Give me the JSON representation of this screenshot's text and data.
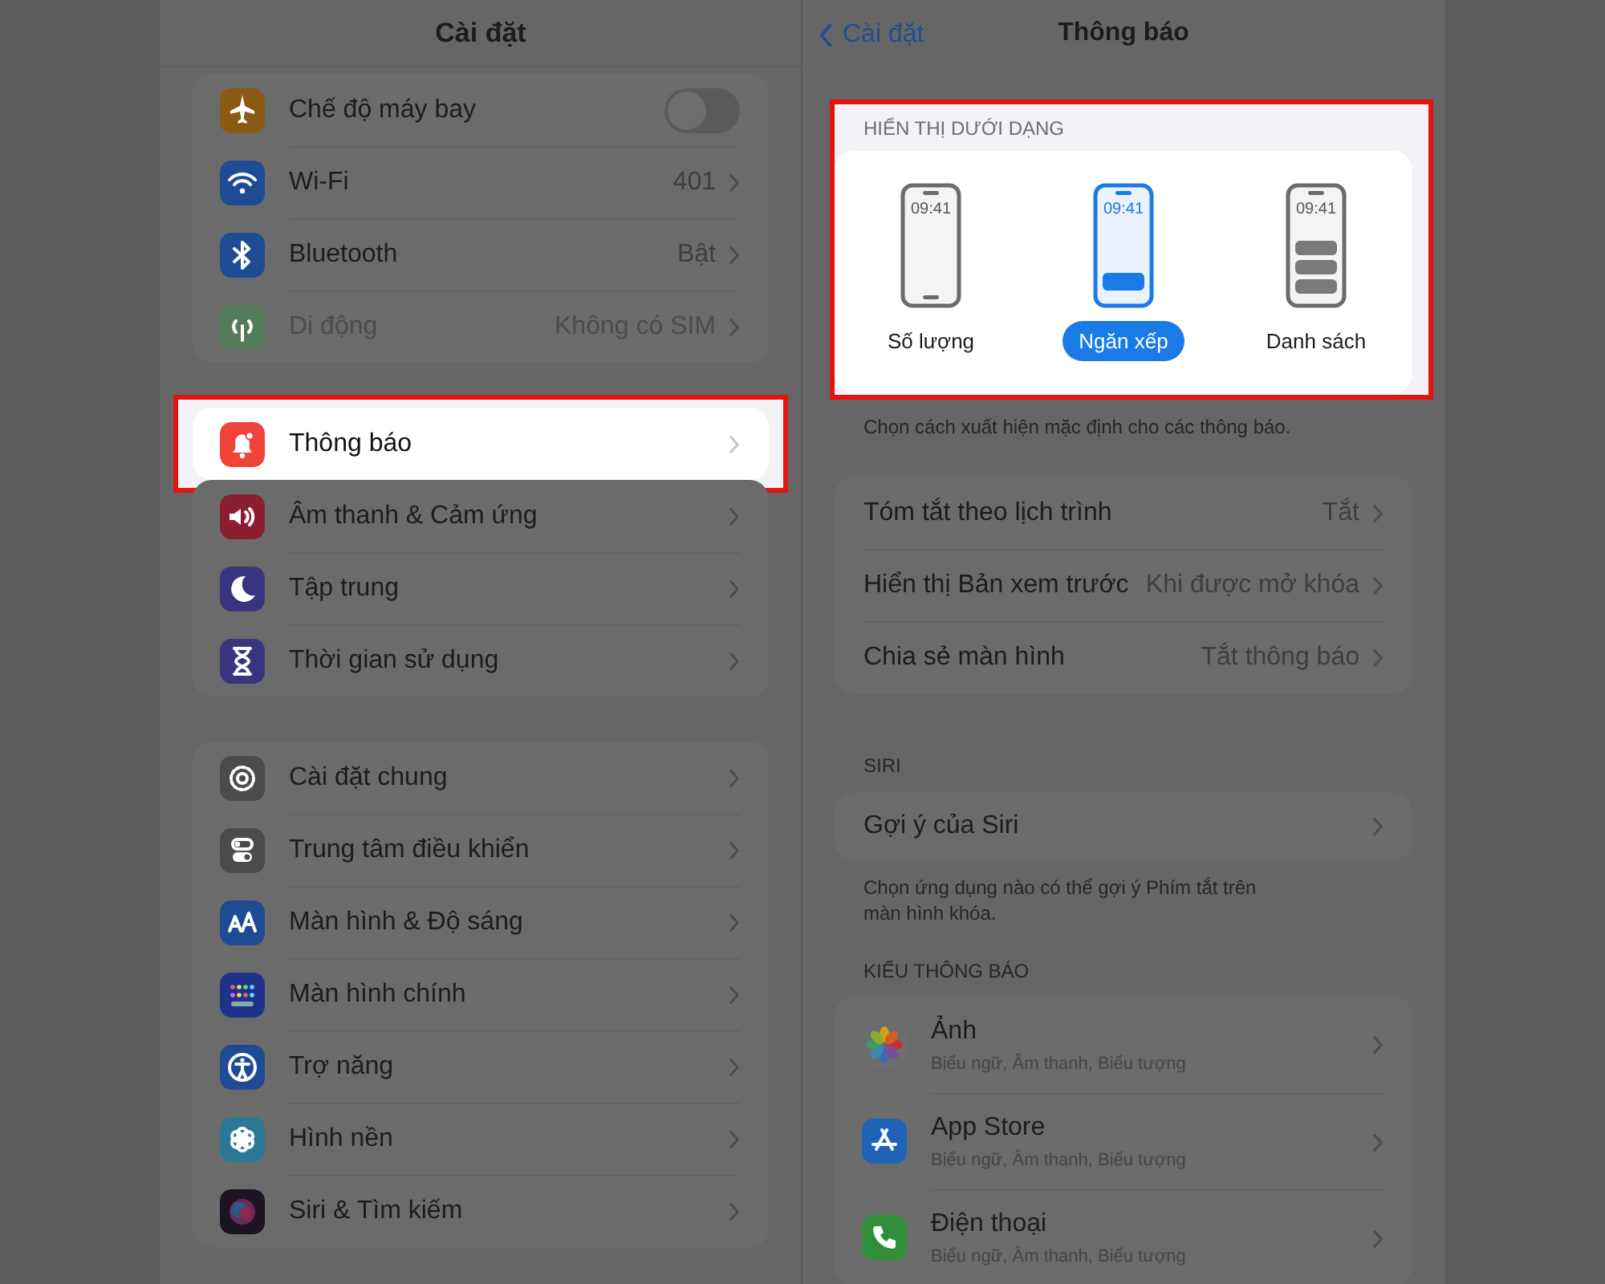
{
  "settings": {
    "title": "Cài đặt",
    "groups": [
      {
        "items": [
          {
            "label": "Chế độ máy bay",
            "kind": "toggle",
            "on": false,
            "highlighted": false,
            "disabled": false
          },
          {
            "label": "Wi-Fi",
            "value": "401",
            "kind": "link",
            "highlighted": false,
            "disabled": false
          },
          {
            "label": "Bluetooth",
            "value": "Bật",
            "kind": "link",
            "highlighted": false,
            "disabled": false
          },
          {
            "label": "Di động",
            "value": "Không có SIM",
            "kind": "link",
            "highlighted": false,
            "disabled": true
          }
        ]
      },
      {
        "items": [
          {
            "label": "Thông báo",
            "kind": "link",
            "highlighted": true,
            "disabled": false
          },
          {
            "label": "Âm thanh & Cảm ứng",
            "kind": "link",
            "highlighted": false,
            "disabled": false
          },
          {
            "label": "Tập trung",
            "kind": "link",
            "highlighted": false,
            "disabled": false
          },
          {
            "label": "Thời gian sử dụng",
            "kind": "link",
            "highlighted": false,
            "disabled": false
          }
        ]
      },
      {
        "items": [
          {
            "label": "Cài đặt chung",
            "kind": "link",
            "highlighted": false,
            "disabled": false
          },
          {
            "label": "Trung tâm điều khiển",
            "kind": "link",
            "highlighted": false,
            "disabled": false
          },
          {
            "label": "Màn hình & Độ sáng",
            "kind": "link",
            "highlighted": false,
            "disabled": false
          },
          {
            "label": "Màn hình chính",
            "kind": "link",
            "highlighted": false,
            "disabled": false
          },
          {
            "label": "Trợ năng",
            "kind": "link",
            "highlighted": false,
            "disabled": false
          },
          {
            "label": "Hình nền",
            "kind": "link",
            "highlighted": false,
            "disabled": false
          },
          {
            "label": "Siri & Tìm kiếm",
            "kind": "link",
            "highlighted": false,
            "disabled": false
          }
        ]
      }
    ]
  },
  "notifications": {
    "back": "Cài đặt",
    "title": "Thông báo",
    "display_as": {
      "header": "HIỂN THỊ DƯỚI DẠNG",
      "highlighted": true,
      "options": [
        {
          "kind": "count",
          "time": "09:41",
          "label": "Số lượng",
          "selected": false
        },
        {
          "kind": "stack",
          "time": "09:41",
          "label": "Ngăn xếp",
          "selected": true
        },
        {
          "kind": "list",
          "time": "09:41",
          "label": "Danh sách",
          "selected": false
        }
      ],
      "footer": "Chọn cách xuất hiện mặc định cho các thông báo."
    },
    "rows": [
      {
        "label": "Tóm tắt theo lịch trình",
        "value": "Tắt"
      },
      {
        "label": "Hiển thị Bản xem trước",
        "value": "Khi được mở khóa"
      },
      {
        "label": "Chia sẻ màn hình",
        "value": "Tắt thông báo"
      }
    ],
    "siri": {
      "header": "SIRI",
      "rows": [
        {
          "label": "Gợi ý của Siri"
        }
      ],
      "footer": "Chọn ứng dụng nào có thể gợi ý Phím tắt trên màn hình khóa."
    },
    "styles": {
      "header": "KIỂU THÔNG BÁO",
      "apps": [
        {
          "name": "Ảnh",
          "detail": "Biểu ngữ, Âm thanh, Biểu tượng"
        },
        {
          "name": "App Store",
          "detail": "Biểu ngữ, Âm thanh, Biểu tượng"
        },
        {
          "name": "Điện thoại",
          "detail": "Biểu ngữ, Âm thanh, Biểu tượng"
        }
      ]
    }
  }
}
